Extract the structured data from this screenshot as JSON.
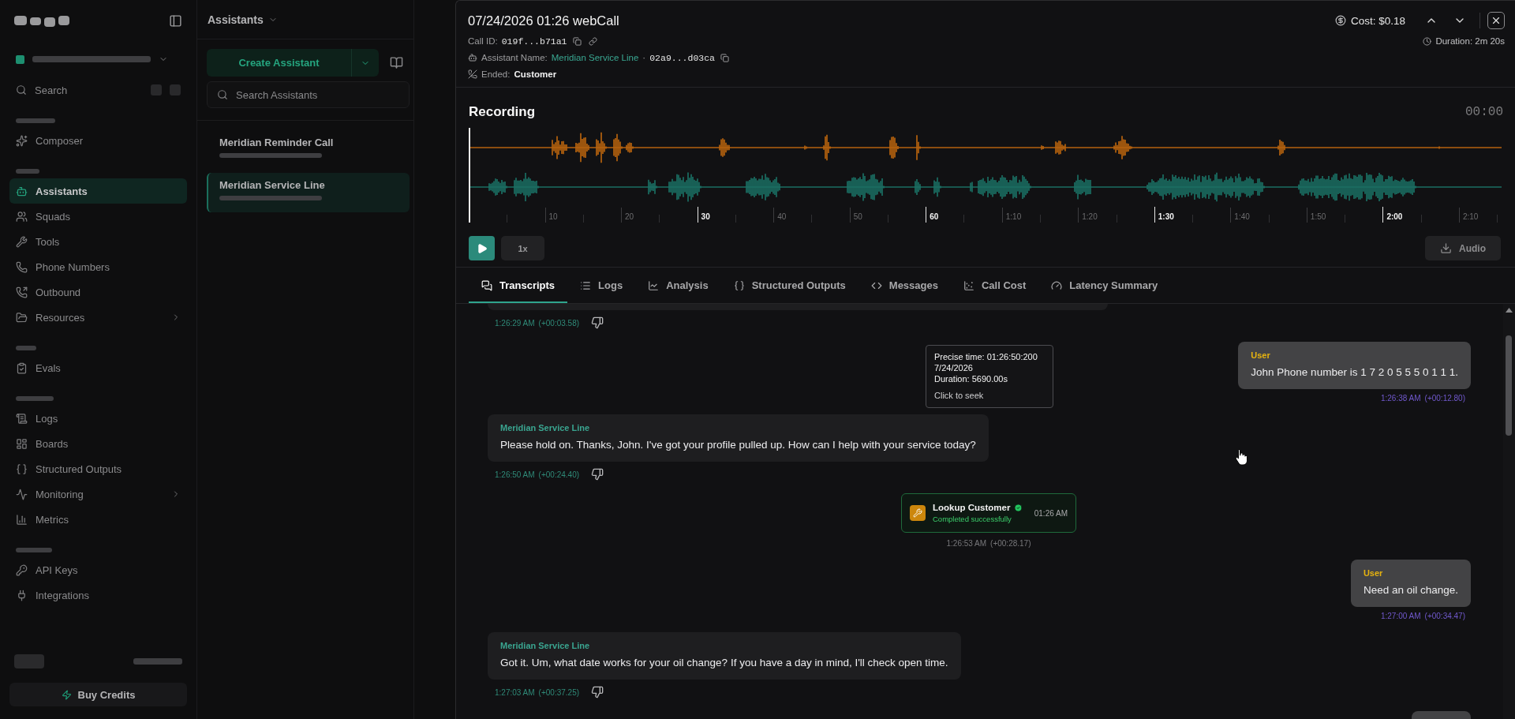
{
  "backdrop": {
    "sidebar": {
      "search": {
        "placeholder": "Search"
      },
      "groups": [
        {
          "items": [
            {
              "label": "Composer",
              "selected": false,
              "expandable": false
            }
          ]
        },
        {
          "items": [
            {
              "label": "Assistants",
              "selected": true,
              "expandable": false
            },
            {
              "label": "Squads",
              "selected": false,
              "expandable": false
            },
            {
              "label": "Tools",
              "selected": false,
              "expandable": false
            },
            {
              "label": "Phone Numbers",
              "selected": false,
              "expandable": false
            },
            {
              "label": "Outbound",
              "selected": false,
              "expandable": false
            },
            {
              "label": "Resources",
              "selected": false,
              "expandable": true
            }
          ]
        },
        {
          "items": [
            {
              "label": "Evals",
              "selected": false,
              "expandable": false
            }
          ]
        },
        {
          "items": [
            {
              "label": "Logs",
              "selected": false,
              "expandable": false
            },
            {
              "label": "Boards",
              "selected": false,
              "expandable": false
            },
            {
              "label": "Structured Outputs",
              "selected": false,
              "expandable": false
            },
            {
              "label": "Monitoring",
              "selected": false,
              "expandable": true
            },
            {
              "label": "Metrics",
              "selected": false,
              "expandable": false
            }
          ]
        },
        {
          "items": [
            {
              "label": "API Keys",
              "selected": false,
              "expandable": false
            },
            {
              "label": "Integrations",
              "selected": false,
              "expandable": false
            }
          ]
        }
      ],
      "buy_button": "Buy Credits"
    },
    "assistants_panel": {
      "title": "Assistants",
      "create_button": "Create Assistant",
      "search": {
        "placeholder": "Search Assistants"
      },
      "items": [
        {
          "name": "Meridian Reminder Call",
          "selected": false
        },
        {
          "name": "Meridian Service Line",
          "selected": true
        }
      ]
    }
  },
  "call": {
    "title": "07/24/2026 01:26 webCall",
    "call_id": {
      "label": "Call ID:",
      "value": "019f...b71a1"
    },
    "assistant": {
      "label": "Assistant Name:",
      "name": "Meridian Service Line",
      "separator": "·",
      "id": "02a9...d03ca"
    },
    "ended": {
      "label": "Ended:",
      "value": "Customer"
    },
    "cost": "Cost: $0.18",
    "duration": "Duration: 2m 20s"
  },
  "recording": {
    "title": "Recording",
    "time": "00:00",
    "tracks": [
      {
        "color": "#b5620f"
      },
      {
        "color": "#1b6e63"
      }
    ],
    "ticks": [
      {
        "label": "10",
        "major": false
      },
      {
        "label": "20",
        "major": false
      },
      {
        "label": "30",
        "major": true
      },
      {
        "label": "40",
        "major": false
      },
      {
        "label": "50",
        "major": false
      },
      {
        "label": "60",
        "major": true
      },
      {
        "label": "1:10",
        "major": false
      },
      {
        "label": "1:20",
        "major": false
      },
      {
        "label": "1:30",
        "major": true
      },
      {
        "label": "1:40",
        "major": false
      },
      {
        "label": "1:50",
        "major": false
      },
      {
        "label": "2:00",
        "major": true
      },
      {
        "label": "2:10",
        "major": false
      }
    ],
    "speed": "1x",
    "download_button": "Audio"
  },
  "tabs": [
    {
      "label": "Transcripts",
      "selected": true
    },
    {
      "label": "Logs",
      "selected": false
    },
    {
      "label": "Analysis",
      "selected": false
    },
    {
      "label": "Structured Outputs",
      "selected": false
    },
    {
      "label": "Messages",
      "selected": false
    },
    {
      "label": "Call Cost",
      "selected": false
    },
    {
      "label": "Latency Summary",
      "selected": false
    }
  ],
  "transcript": {
    "messages": [
      {
        "kind": "assistant",
        "time": "1:26:29 AM",
        "offset": "(+00:03.58)"
      },
      {
        "kind": "user",
        "speaker": "User",
        "text": "John Phone number is 1 7 2 0 5 5 5 0 1 1 1.",
        "time": "1:26:38 AM",
        "offset": "(+00:12.80)"
      },
      {
        "kind": "assistant",
        "speaker": "Meridian Service Line",
        "text": "Please hold on. Thanks, John. I've got your profile pulled up. How can I help with your service today?",
        "time": "1:26:50 AM",
        "offset": "(+00:24.40)"
      },
      {
        "kind": "tool",
        "name": "Lookup Customer",
        "status": "Completed successfully",
        "clock": "01:26 AM",
        "time": "1:26:53 AM",
        "offset": "(+00:28.17)"
      },
      {
        "kind": "user",
        "speaker": "User",
        "text": "Need an oil change.",
        "time": "1:27:00 AM",
        "offset": "(+00:34.47)"
      },
      {
        "kind": "assistant",
        "speaker": "Meridian Service Line",
        "text": "Got it. Um, what date works for your oil change? If you have a day in mind, I'll check open time.",
        "time": "1:27:03 AM",
        "offset": "(+00:37.25)"
      },
      {
        "kind": "user"
      }
    ],
    "tooltip": {
      "lines": [
        "Precise time: 01:26:50:200",
        "7/24/2026",
        "Duration: 5690.00s"
      ],
      "hint": "Click to seek"
    }
  }
}
